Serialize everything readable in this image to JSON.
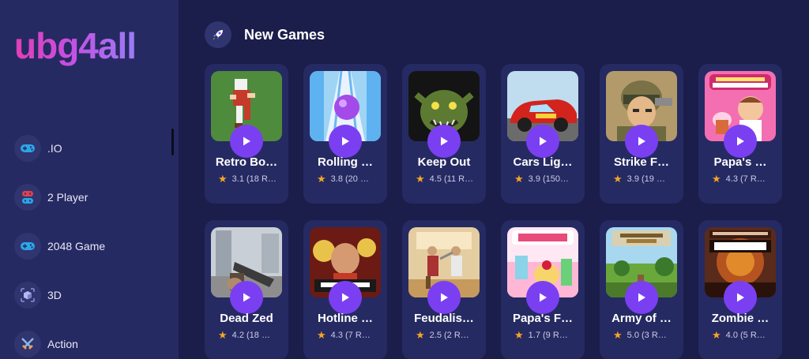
{
  "brand": {
    "logo_text": "ubg4all"
  },
  "sidebar": {
    "items": [
      {
        "label": ".IO",
        "icon": "gamepad-icon",
        "color": "#2aa7e8"
      },
      {
        "label": "2 Player",
        "icon": "two-player-icon",
        "color": "#e0414f"
      },
      {
        "label": "2048 Game",
        "icon": "gamepad-icon",
        "color": "#2aa7e8"
      },
      {
        "label": "3D",
        "icon": "cube-icon",
        "color": "#8a8fd6"
      },
      {
        "label": "Action",
        "icon": "swords-icon",
        "color": "#8db3e8"
      }
    ]
  },
  "main": {
    "section_title": "New Games",
    "section_icon": "rocket-icon",
    "games": [
      {
        "title": "Retro Bo…",
        "rating": "3.1 (18 R…",
        "art": "retro"
      },
      {
        "title": "Rolling …",
        "rating": "3.8 (20 …",
        "art": "rolling"
      },
      {
        "title": "Keep Out",
        "rating": "4.5 (11 R…",
        "art": "keepout"
      },
      {
        "title": "Cars Lig…",
        "rating": "3.9 (150…",
        "art": "cars"
      },
      {
        "title": "Strike F…",
        "rating": "3.9 (19 …",
        "art": "strike"
      },
      {
        "title": "Papa's …",
        "rating": "4.3 (7 R…",
        "art": "cupcakeria"
      },
      {
        "title": "Dead Zed",
        "rating": "4.2 (18 …",
        "art": "deadzed"
      },
      {
        "title": "Hotline …",
        "rating": "4.3 (7 R…",
        "art": "hotline"
      },
      {
        "title": "Feudalis…",
        "rating": "2.5 (2 R…",
        "art": "feudalism"
      },
      {
        "title": "Papa's F…",
        "rating": "1.7 (9 R…",
        "art": "freezeria"
      },
      {
        "title": "Army of …",
        "rating": "5.0 (3 R…",
        "art": "army"
      },
      {
        "title": "Zombie …",
        "rating": "4.0 (5 R…",
        "art": "zombie"
      }
    ]
  },
  "colors": {
    "accent": "#7b3ff2",
    "star": "#f5a623",
    "sidebar_bg": "#262a62",
    "page_bg": "#1b1d4a"
  }
}
